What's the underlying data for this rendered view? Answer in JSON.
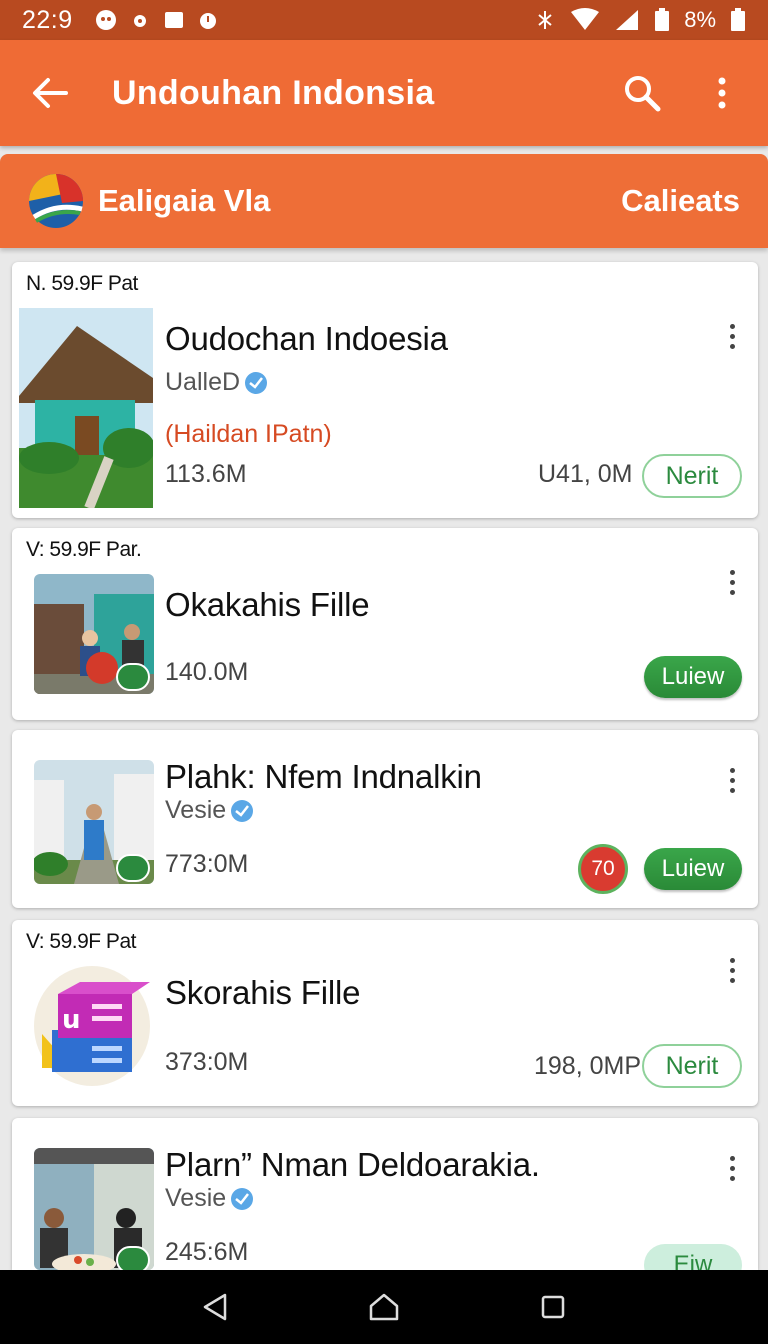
{
  "status_bar": {
    "time": "22:9",
    "battery_text": "8%",
    "icons": [
      "notification-icon",
      "settings-icon",
      "image-icon",
      "alarm-icon",
      "bluetooth-icon",
      "wifi-icon",
      "signal-icon",
      "battery-icon"
    ]
  },
  "app_bar": {
    "title": "Undouhan Indonsia",
    "icons": [
      "back-arrow-icon",
      "search-icon",
      "more-vert-icon"
    ]
  },
  "category_bar": {
    "title": "Ealigaia Vla",
    "action": "Calieats"
  },
  "cards": [
    {
      "meta": "N. 59.9F Pat",
      "title": "Oudochan Indoesia",
      "subtitle": "UalleD",
      "tag": "(Haildan IPatn)",
      "size": "113.6M",
      "right_value": "U41, 0M",
      "button": "Nerit"
    },
    {
      "meta": "V: 59.9F Par.",
      "title": "Okakahis Fille",
      "size": "140.0M",
      "button": "Luiew"
    },
    {
      "title": "Plahk: Nfem Indnalkin",
      "subtitle": "Vesie",
      "size": "773:0M",
      "badge": "70",
      "button": "Luiew"
    },
    {
      "meta": "V: 59.9F Pat",
      "title": "Skorahis Fille",
      "size": "373:0M",
      "right_value": "198, 0MP",
      "button": "Nerit"
    },
    {
      "title": "Plarn” Nman Deldoarakia.",
      "subtitle": "Vesie",
      "size": "245:6M",
      "button": "Eiw"
    }
  ],
  "colors": {
    "status_bar": "#b84a20",
    "app_bar": "#ef6b35",
    "accent_green": "#2b8a3e",
    "badge_red": "#d93b30"
  }
}
